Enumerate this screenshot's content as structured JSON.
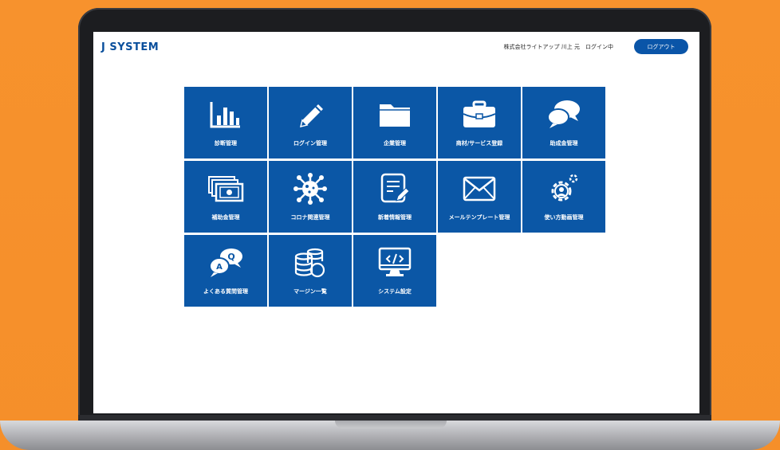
{
  "header": {
    "logo": "J SYSTEM",
    "user_status": "株式会社ライトアップ 川上 元　ログイン中",
    "logout_label": "ログアウト"
  },
  "menu": [
    {
      "label": "診断管理",
      "icon": "bar-chart-icon"
    },
    {
      "label": "ログイン管理",
      "icon": "pencil-icon"
    },
    {
      "label": "企業管理",
      "icon": "folder-icon"
    },
    {
      "label": "商材/サービス登録",
      "icon": "briefcase-icon"
    },
    {
      "label": "助成金管理",
      "icon": "chat-bubbles-icon"
    },
    {
      "label": "補助金管理",
      "icon": "banknotes-icon"
    },
    {
      "label": "コロナ関連管理",
      "icon": "virus-icon"
    },
    {
      "label": "新着情報管理",
      "icon": "document-edit-icon"
    },
    {
      "label": "メールテンプレート管理",
      "icon": "envelope-icon"
    },
    {
      "label": "使い方動画管理",
      "icon": "gear-user-icon"
    },
    {
      "label": "よくある質問管理",
      "icon": "qa-bubbles-icon"
    },
    {
      "label": "マージン一覧",
      "icon": "coins-icon"
    },
    {
      "label": "システム設定",
      "icon": "monitor-code-icon"
    }
  ],
  "colors": {
    "background": "#f7922d",
    "tile": "#0b57a6",
    "brand": "#0a4f9c",
    "button": "#0a55a8"
  }
}
